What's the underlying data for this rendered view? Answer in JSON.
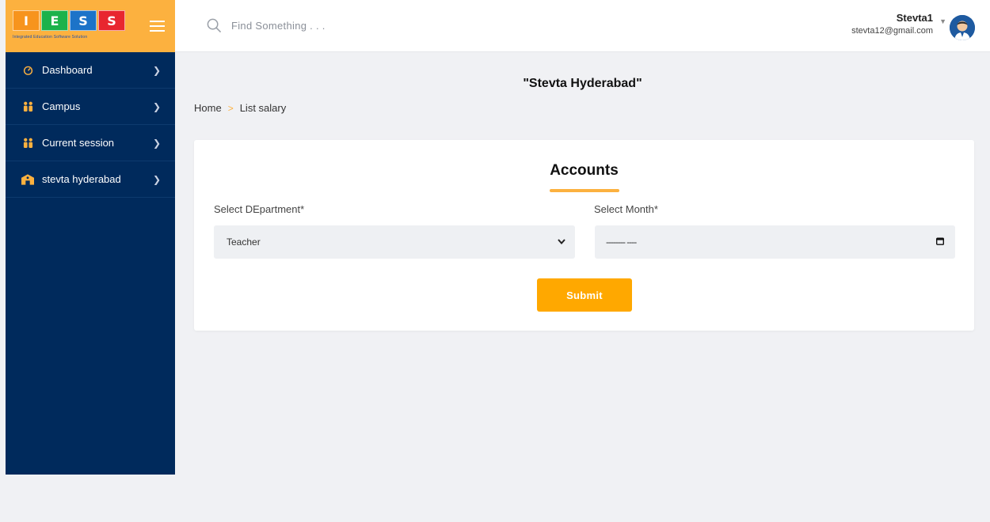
{
  "brand": {
    "logo_letters": [
      "I",
      "E",
      "S",
      "S"
    ],
    "logo_colors": [
      "#f7941d",
      "#1cb24b",
      "#1c73c8",
      "#e8262f"
    ],
    "tagline": "Integrated Education Software Solution",
    "menu_icon": "hamburger-icon"
  },
  "sidebar": {
    "items": [
      {
        "label": "Dashboard",
        "icon": "speedometer-icon"
      },
      {
        "label": "Campus",
        "icon": "people-icon"
      },
      {
        "label": "Current session",
        "icon": "people-icon"
      },
      {
        "label": "stevta hyderabad",
        "icon": "school-icon"
      }
    ]
  },
  "header": {
    "search_placeholder": "Find Something . . .",
    "user_name": "Stevta1",
    "user_email": "stevta12@gmail.com"
  },
  "page": {
    "title": "\"Stevta Hyderabad\"",
    "breadcrumb": {
      "home": "Home",
      "separator": ">",
      "current": "List salary"
    }
  },
  "form": {
    "title": "Accounts",
    "department_label": "Select DEpartment*",
    "department_value": "Teacher",
    "month_label": "Select Month*",
    "month_value": "-------- ----",
    "submit_label": "Submit"
  },
  "colors": {
    "sidebar_bg": "#002a5c",
    "brand_bg": "#fcb13f",
    "accent": "#ffa800",
    "page_bg": "#f0f1f4"
  }
}
